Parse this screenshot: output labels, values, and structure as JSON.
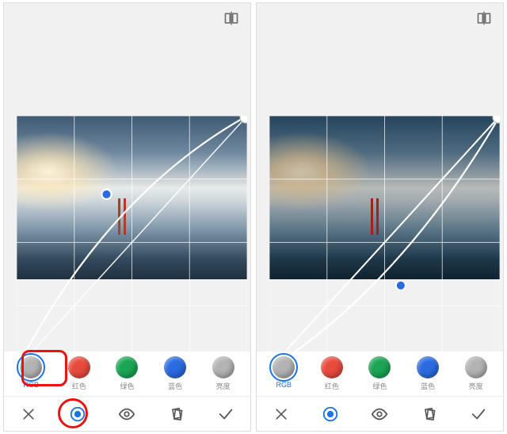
{
  "panes": [
    {
      "id": "left",
      "dark": false,
      "curve": {
        "mid_x": 0.39,
        "mid_y": 0.31,
        "line2": false
      },
      "highlights": {
        "channel_box": true,
        "mode_circle": true
      }
    },
    {
      "id": "right",
      "dark": true,
      "curve": {
        "mid_x": 0.57,
        "mid_y": 0.67,
        "line2": true
      },
      "highlights": {
        "channel_box": false,
        "mode_circle": false
      }
    }
  ],
  "channels": [
    {
      "key": "rgb",
      "label": "RGB",
      "color": "#b3b3b3",
      "selected": true
    },
    {
      "key": "red",
      "label": "红色",
      "color": "#e84b3c",
      "selected": false
    },
    {
      "key": "green",
      "label": "绿色",
      "color": "#1aa554",
      "selected": false
    },
    {
      "key": "blue",
      "label": "蓝色",
      "color": "#2b6be0",
      "selected": false
    },
    {
      "key": "luma",
      "label": "亮度",
      "color": "#b3b3b3",
      "selected": false
    }
  ],
  "toolbar": [
    {
      "key": "cancel",
      "icon": "x",
      "interact": true,
      "active": false
    },
    {
      "key": "mode",
      "icon": "eye-fill",
      "interact": true,
      "active": true
    },
    {
      "key": "preview",
      "icon": "eye",
      "interact": true,
      "active": false
    },
    {
      "key": "styles",
      "icon": "cards",
      "interact": true,
      "active": false
    },
    {
      "key": "apply",
      "icon": "check",
      "interact": true,
      "active": false
    }
  ],
  "icons": {
    "compare": "compare"
  }
}
